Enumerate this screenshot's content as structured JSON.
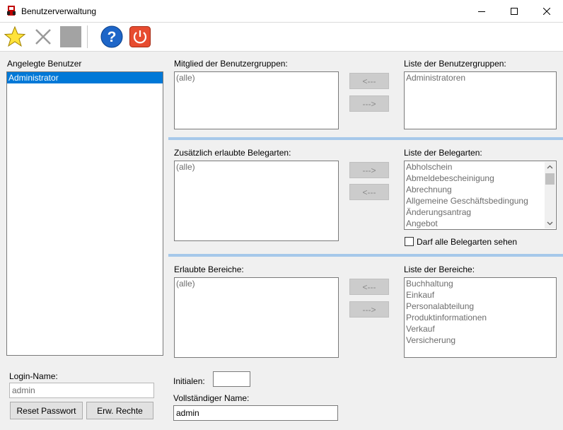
{
  "window": {
    "title": "Benutzerverwaltung"
  },
  "icons": {
    "app": "app-icon",
    "new": "star-icon",
    "delete": "close-icon",
    "save": "save-icon",
    "help": "help-icon",
    "exit": "power-icon"
  },
  "users": {
    "label": "Angelegte Benutzer",
    "items": [
      "Administrator"
    ]
  },
  "groups": {
    "member_label": "Mitglied der Benutzergruppen:",
    "member_items": [
      "(alle)"
    ],
    "list_label": "Liste der Benutzergruppen:",
    "list_items": [
      "Administratoren"
    ],
    "btn_remove": "<---",
    "btn_add": "--->"
  },
  "doctypes": {
    "allowed_label": "Zusätzlich erlaubte Belegarten:",
    "allowed_items": [
      "(alle)"
    ],
    "list_label": "Liste der Belegarten:",
    "list_items": [
      "Abholschein",
      "Abmeldebescheinigung",
      "Abrechnung",
      "Allgemeine Geschäftsbedingung",
      "Änderungsantrag",
      "Angebot"
    ],
    "btn_add": "--->",
    "btn_remove": "<---",
    "see_all_label": "Darf alle Belegarten sehen"
  },
  "areas": {
    "allowed_label": "Erlaubte Bereiche:",
    "allowed_items": [
      "(alle)"
    ],
    "list_label": "Liste der  Bereiche:",
    "list_items": [
      "Buchhaltung",
      "Einkauf",
      "Personalabteilung",
      "Produktinformationen",
      "Verkauf",
      "Versicherung"
    ],
    "btn_remove": "<---",
    "btn_add": "--->"
  },
  "login": {
    "label": "Login-Name:",
    "value": "admin",
    "reset_btn": "Reset Passwort",
    "rights_btn": "Erw. Rechte"
  },
  "initials": {
    "label": "Initialen:",
    "value": ""
  },
  "fullname": {
    "label": "Vollständiger Name:",
    "value": "admin"
  }
}
